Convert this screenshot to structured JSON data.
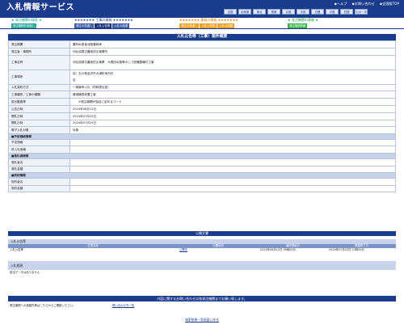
{
  "header": {
    "app_title": "入札情報サービス",
    "top_links": [
      "◆ヘルプ",
      "◆お問い合わせ",
      "◆全国版TOP"
    ],
    "regions": [
      "全国",
      "北海道",
      "東北",
      "関東",
      "北陸",
      "中部",
      "近畿",
      "中国",
      "四国",
      "九州・沖縄"
    ]
  },
  "nav": {
    "groups": [
      {
        "title": "★ 発注機関の検索 ★",
        "tabs": [
          "発注機関を検索し"
        ]
      },
      {
        "title": "★★★★★★★ 工事の情報 ★★★★★★★",
        "tabs": [
          "発注の見通し",
          "入札公告等",
          "入札の結果"
        ],
        "active": 1
      },
      {
        "title": "★★★★★★★ 業務の情報 ★★★★★★★",
        "tabs": [
          "発注の見通し",
          "入札公告等",
          "入札の結果"
        ]
      },
      {
        "title": "★ 発注機関の情報 ★",
        "tabs": [
          "発注機関情報"
        ]
      }
    ]
  },
  "detail": {
    "title": "入札公告等（工事）案件概要",
    "rows": [
      {
        "label": "発注機関",
        "value": "農林水産省北陸農政局"
      },
      {
        "label": "発注者・事務所",
        "value": "河北潟周辺農地防災事業所"
      },
      {
        "label": "工事名称",
        "value": "河北潟周辺農地防災事業　大根田水路等ポンプ設備整備付工事"
      },
      {
        "label": "工事場所",
        "value": "自）石川県金沢市大浦町地内外",
        "value2": "至"
      },
      {
        "label": "入札契約方式",
        "value": "一般競争入札（同時提出型）"
      },
      {
        "label": "工事種別／工事の種類",
        "value": "機械器具設置工事"
      },
      {
        "label": "設計審査等",
        "value": "　　※発注機関が独自に定めるコード"
      },
      {
        "label": "公告日時",
        "value": "2024年06月12日"
      },
      {
        "label": "開札日時",
        "value": "2024年07月25日"
      },
      {
        "label": "開札日時",
        "value": "2024年07月25日"
      },
      {
        "label": "電子入札対象",
        "value": "対象"
      }
    ],
    "sections": [
      {
        "title": "■予定価格情報",
        "rows": [
          "予定価格",
          "低入札価格"
        ]
      },
      {
        "title": "■落札者情報",
        "rows": [
          "落札者名",
          "落札金額"
        ]
      },
      {
        "title": "■契約情報",
        "rows": [
          "契約者名",
          "契約金額"
        ]
      }
    ]
  },
  "documents": {
    "bar": "公開文書",
    "group_title": "入札公告等",
    "columns": [
      "文書名称",
      "公開状況",
      "最終更新日",
      "掲載終了日"
    ],
    "rows": [
      [
        "入札公告等",
        "公開中",
        "2024年06月12日 09時00分",
        "2024年07月25日 23時59分"
      ]
    ]
  },
  "results": {
    "group_title": "入札経過",
    "empty": "該当データはありません"
  },
  "contact": {
    "bar": "内容に関するお問い合わせは各発注機関までお願い致します。",
    "text": "発注機関への連絡先等はこちらからご確認ください。",
    "link": "問い合わせ先一覧"
  },
  "footer": {
    "link": "検索結果一覧画面に戻る"
  }
}
